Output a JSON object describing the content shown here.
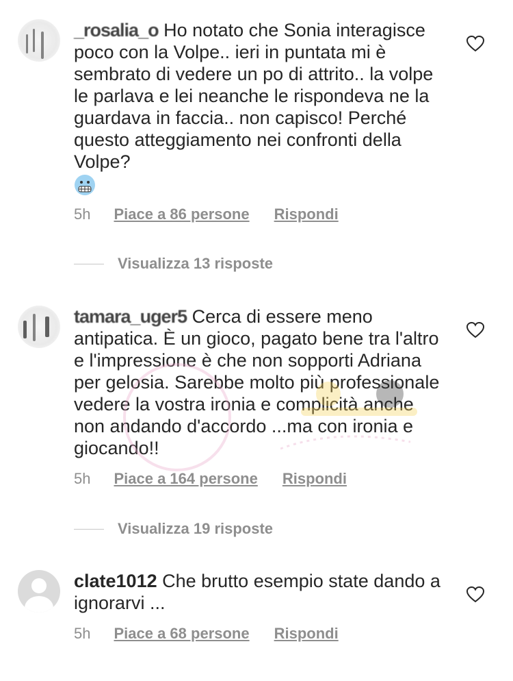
{
  "comments": [
    {
      "username": "_rosalia_o",
      "text": "Ho notato che Sonia interagisce poco con la Volpe.. ieri in puntata mi è sembrato di vedere un po di attrito.. la volpe le parlava e lei neanche le rispondeva ne la guardava in faccia.. non capisco! Perché questo atteggiamento nei confronti della Volpe?",
      "emoji": "grimacing-face-emoji",
      "time": "5h",
      "likes": "Piace a 86 persone",
      "reply": "Rispondi",
      "view_replies": "Visualizza 13 risposte"
    },
    {
      "username": "tamara_uger5",
      "text": "Cerca di essere meno antipatica. È un gioco, pagato bene tra l'altro e l'impressione è che non sopporti Adriana per gelosia. Sarebbe molto più professionale vedere la vostra ironia e complicità anche non andando d'accordo ...ma con ironia e giocando!!",
      "time": "5h",
      "likes": "Piace a 164 persone",
      "reply": "Rispondi",
      "view_replies": "Visualizza 19 risposte"
    },
    {
      "username": "clate1012",
      "text": "Che brutto esempio state dando a ignorarvi ...",
      "time": "5h",
      "likes": "Piace a 68 persone",
      "reply": "Rispondi"
    }
  ],
  "colors": {
    "text": "#262626",
    "meta": "#8e8e8e",
    "divider": "#c7c7c7"
  }
}
